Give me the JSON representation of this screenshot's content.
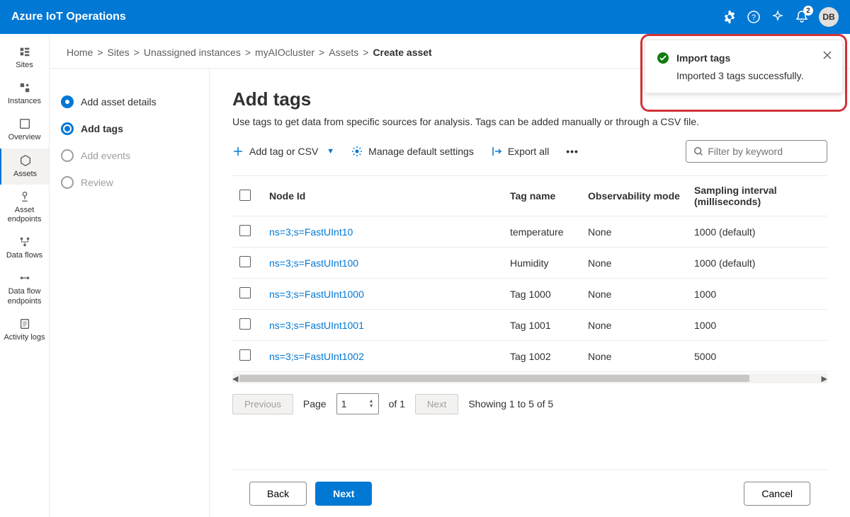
{
  "header": {
    "title": "Azure IoT Operations",
    "notification_count": "2",
    "avatar_initials": "DB"
  },
  "sidebar": {
    "items": [
      {
        "label": "Sites"
      },
      {
        "label": "Instances"
      },
      {
        "label": "Overview"
      },
      {
        "label": "Assets"
      },
      {
        "label": "Asset endpoints"
      },
      {
        "label": "Data flows"
      },
      {
        "label": "Data flow endpoints"
      },
      {
        "label": "Activity logs"
      }
    ]
  },
  "breadcrumb": {
    "items": [
      "Home",
      "Sites",
      "Unassigned instances",
      "myAIOcluster",
      "Assets"
    ],
    "current": "Create asset"
  },
  "steps": {
    "items": [
      {
        "label": "Add asset details"
      },
      {
        "label": "Add tags"
      },
      {
        "label": "Add events"
      },
      {
        "label": "Review"
      }
    ]
  },
  "page": {
    "title": "Add tags",
    "description": "Use tags to get data from specific sources for analysis. Tags can be added manually or through a CSV file."
  },
  "toolbar": {
    "add_tag": "Add tag or CSV",
    "manage_defaults": "Manage default settings",
    "export_all": "Export all",
    "filter_placeholder": "Filter by keyword"
  },
  "table": {
    "headers": {
      "node_id": "Node Id",
      "tag_name": "Tag name",
      "observability": "Observability mode",
      "sampling": "Sampling interval (milliseconds)"
    },
    "rows": [
      {
        "node_id": "ns=3;s=FastUInt10",
        "tag_name": "temperature",
        "observability": "None",
        "sampling": "1000 (default)"
      },
      {
        "node_id": "ns=3;s=FastUInt100",
        "tag_name": "Humidity",
        "observability": "None",
        "sampling": "1000 (default)"
      },
      {
        "node_id": "ns=3;s=FastUInt1000",
        "tag_name": "Tag 1000",
        "observability": "None",
        "sampling": "1000"
      },
      {
        "node_id": "ns=3;s=FastUInt1001",
        "tag_name": "Tag 1001",
        "observability": "None",
        "sampling": "1000"
      },
      {
        "node_id": "ns=3;s=FastUInt1002",
        "tag_name": "Tag 1002",
        "observability": "None",
        "sampling": "5000"
      }
    ]
  },
  "pager": {
    "previous": "Previous",
    "next": "Next",
    "page_label": "Page",
    "page_value": "1",
    "of_label": "of 1",
    "showing": "Showing 1 to 5 of 5"
  },
  "footer": {
    "back": "Back",
    "next": "Next",
    "cancel": "Cancel"
  },
  "toast": {
    "title": "Import tags",
    "body": "Imported 3 tags successfully."
  }
}
